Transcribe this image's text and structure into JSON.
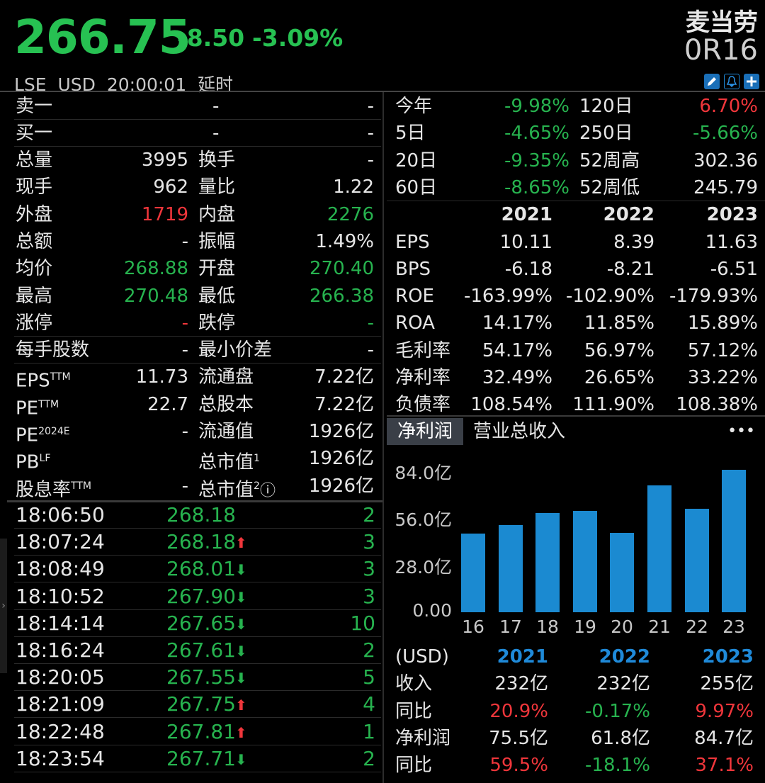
{
  "header": {
    "price": "266.75",
    "change": "-8.50",
    "change_pct": "-3.09%",
    "name": "麦当劳",
    "code": "0R16",
    "exchange": "LSE",
    "currency": "USD",
    "time": "20:00:01",
    "delay": "延时"
  },
  "colors": {
    "up": "#f0363b",
    "down": "#27b34f",
    "accent": "#1f8ad9",
    "bar": "#1b8ad1"
  },
  "quote": {
    "ask_label": "卖一",
    "ask_price": "-",
    "ask_vol": "-",
    "bid_label": "买一",
    "bid_price": "-",
    "bid_vol": "-",
    "rows": [
      {
        "l1": "总量",
        "v1": "3995",
        "l2": "换手",
        "v2": "-"
      },
      {
        "l1": "现手",
        "v1": "962",
        "l2": "量比",
        "v2": "1.22"
      },
      {
        "l1": "外盘",
        "v1": "1719",
        "l2": "内盘",
        "v2": "2276"
      },
      {
        "l1": "总额",
        "v1": "-",
        "l2": "振幅",
        "v2": "1.49%"
      },
      {
        "l1": "均价",
        "v1": "268.88",
        "l2": "开盘",
        "v2": "270.40"
      },
      {
        "l1": "最高",
        "v1": "270.48",
        "l2": "最低",
        "v2": "266.38"
      },
      {
        "l1": "涨停",
        "v1": "-",
        "l2": "跌停",
        "v2": "-"
      }
    ],
    "lot_label": "每手股数",
    "lot_value": "-",
    "tick_label": "最小价差",
    "tick_value": "-",
    "rows2": [
      {
        "l1": "EPS",
        "s1": "TTM",
        "v1": "11.73",
        "l2": "流通盘",
        "s2": "",
        "v2": "7.22亿"
      },
      {
        "l1": "PE",
        "s1": "TTM",
        "v1": "22.7",
        "l2": "总股本",
        "s2": "",
        "v2": "7.22亿"
      },
      {
        "l1": "PE",
        "s1": "2024E",
        "v1": "-",
        "l2": "流通值",
        "s2": "",
        "v2": "1926亿"
      },
      {
        "l1": "PB",
        "s1": "LF",
        "v1": "",
        "l2": "总市值",
        "s2": "1",
        "v2": "1926亿"
      },
      {
        "l1": "股息率",
        "s1": "TTM",
        "v1": "-",
        "l2": "总市值",
        "s2": "2",
        "v2": "1926亿"
      }
    ]
  },
  "ticks": [
    {
      "time": "18:06:50",
      "price": "268.18",
      "arrow": "",
      "vol": "2"
    },
    {
      "time": "18:07:24",
      "price": "268.18",
      "arrow": "up",
      "vol": "3"
    },
    {
      "time": "18:08:49",
      "price": "268.01",
      "arrow": "down",
      "vol": "3"
    },
    {
      "time": "18:10:52",
      "price": "267.90",
      "arrow": "down",
      "vol": "3"
    },
    {
      "time": "18:14:14",
      "price": "267.65",
      "arrow": "down",
      "vol": "10"
    },
    {
      "time": "18:16:24",
      "price": "267.61",
      "arrow": "down",
      "vol": "2"
    },
    {
      "time": "18:20:05",
      "price": "267.55",
      "arrow": "down",
      "vol": "5"
    },
    {
      "time": "18:21:09",
      "price": "267.75",
      "arrow": "up",
      "vol": "4"
    },
    {
      "time": "18:22:48",
      "price": "267.81",
      "arrow": "up",
      "vol": "1"
    },
    {
      "time": "18:23:54",
      "price": "267.71",
      "arrow": "down",
      "vol": "2"
    }
  ],
  "performance": [
    {
      "l1": "今年",
      "v1": "-9.98%",
      "c1": "down",
      "l2": "120日",
      "v2": "6.70%",
      "c2": "up"
    },
    {
      "l1": "5日",
      "v1": "-4.65%",
      "c1": "down",
      "l2": "250日",
      "v2": "-5.66%",
      "c2": "down"
    },
    {
      "l1": "20日",
      "v1": "-9.35%",
      "c1": "down",
      "l2": "52周高",
      "v2": "302.36",
      "c2": ""
    },
    {
      "l1": "60日",
      "v1": "-8.65%",
      "c1": "down",
      "l2": "52周低",
      "v2": "245.79",
      "c2": ""
    }
  ],
  "fundamentals": {
    "years": [
      "2021",
      "2022",
      "2023"
    ],
    "rows": [
      {
        "label": "EPS",
        "values": [
          "10.11",
          "8.39",
          "11.63"
        ]
      },
      {
        "label": "BPS",
        "values": [
          "-6.18",
          "-8.21",
          "-6.51"
        ]
      },
      {
        "label": "ROE",
        "values": [
          "-163.99%",
          "-102.90%",
          "-179.93%"
        ]
      },
      {
        "label": "ROA",
        "values": [
          "14.17%",
          "11.85%",
          "15.89%"
        ]
      },
      {
        "label": "毛利率",
        "values": [
          "54.17%",
          "56.97%",
          "57.12%"
        ]
      },
      {
        "label": "净利率",
        "values": [
          "32.49%",
          "26.65%",
          "33.22%"
        ]
      },
      {
        "label": "负债率",
        "values": [
          "108.54%",
          "111.90%",
          "108.38%"
        ]
      }
    ]
  },
  "tabs": {
    "active": "净利润",
    "other": "营业总收入",
    "more": "•••"
  },
  "chart_data": {
    "type": "bar",
    "categories": [
      "16",
      "17",
      "18",
      "19",
      "20",
      "21",
      "22",
      "23"
    ],
    "values": [
      46.9,
      51.9,
      59.2,
      60.3,
      47.3,
      75.5,
      61.8,
      84.7
    ],
    "yticks": [
      "84.0亿",
      "56.0亿",
      "28.0亿",
      "0.00"
    ],
    "ylim": [
      0,
      84
    ]
  },
  "summary": {
    "unit": "(USD)",
    "years": [
      "2021",
      "2022",
      "2023"
    ],
    "rows": [
      {
        "label": "收入",
        "values": [
          "232亿",
          "232亿",
          "255亿"
        ],
        "colors": [
          "",
          "",
          ""
        ]
      },
      {
        "label": "同比",
        "values": [
          "20.9%",
          "-0.17%",
          "9.97%"
        ],
        "colors": [
          "up",
          "down",
          "up"
        ]
      },
      {
        "label": "净利润",
        "values": [
          "75.5亿",
          "61.8亿",
          "84.7亿"
        ],
        "colors": [
          "",
          "",
          ""
        ]
      },
      {
        "label": "同比",
        "values": [
          "59.5%",
          "-18.1%",
          "37.1%"
        ],
        "colors": [
          "up",
          "down",
          "up"
        ]
      }
    ]
  }
}
